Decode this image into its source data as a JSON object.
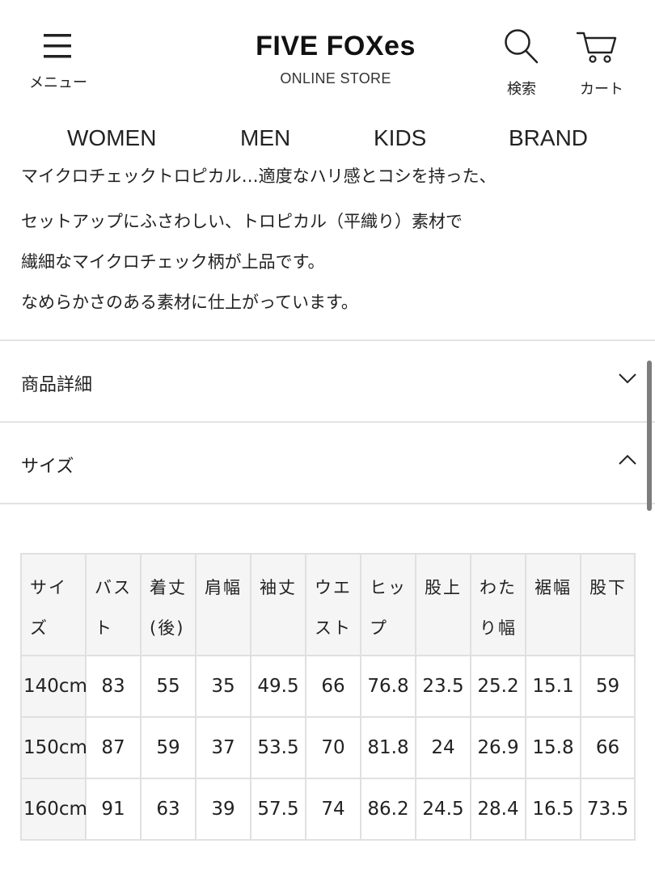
{
  "header": {
    "menu_label": "メニュー",
    "logo_title": "FIVE FOXes",
    "logo_sub": "ONLINE STORE",
    "search_label": "検索",
    "cart_label": "カート"
  },
  "nav": {
    "items": [
      "WOMEN",
      "MEN",
      "KIDS",
      "BRAND"
    ]
  },
  "description": {
    "lines": [
      "マイクロチェックトロピカル…適度なハリ感とコシを持った、",
      "セットアップにふさわしい、トロピカル（平織り）素材で",
      "繊細なマイクロチェック柄が上品です。",
      "なめらかさのある素材に仕上がっています。"
    ]
  },
  "accordions": {
    "details": {
      "label": "商品詳細",
      "state": "collapsed",
      "icon": "chevron-down-icon"
    },
    "size": {
      "label": "サイズ",
      "state": "expanded",
      "icon": "chevron-up-icon"
    }
  },
  "size_table": {
    "headers": [
      "サイズ",
      "バスト",
      "着丈(後)",
      "肩幅",
      "袖丈",
      "ウエスト",
      "ヒップ",
      "股上",
      "わたり幅",
      "裾幅",
      "股下"
    ],
    "rows": [
      [
        "140cm",
        "83",
        "55",
        "35",
        "49.5",
        "66",
        "76.8",
        "23.5",
        "25.2",
        "15.1",
        "59"
      ],
      [
        "150cm",
        "87",
        "59",
        "37",
        "53.5",
        "70",
        "81.8",
        "24",
        "26.9",
        "15.8",
        "66"
      ],
      [
        "160cm",
        "91",
        "63",
        "39",
        "57.5",
        "74",
        "86.2",
        "24.5",
        "28.4",
        "16.5",
        "73.5"
      ]
    ]
  },
  "colors": {
    "text": "#222222",
    "border": "#e0e0e0",
    "header_cell_bg": "#f5f5f5",
    "scrollbar": "#7d7d7d"
  }
}
